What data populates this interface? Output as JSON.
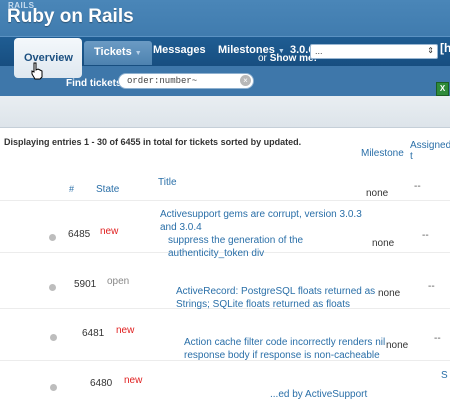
{
  "app": {
    "brand_small": "RAILS",
    "brand_title": "Ruby on Rails"
  },
  "nav": {
    "overview": "Overview",
    "tickets": "Tickets",
    "messages": "Messages",
    "milestones": "Milestones",
    "version": "3.0.6",
    "more": "[h"
  },
  "filter": {
    "find_label": "Find tickets:",
    "search_value": "order:number~",
    "or_label": "or",
    "show_label": "Show me:",
    "show_value": "..."
  },
  "summary": "Displaying entries 1 - 30 of 6455 in total for tickets sorted by updated.",
  "table": {
    "headers": {
      "num": "#",
      "state": "State",
      "title": "Title",
      "milestone": "Milestone",
      "assigned": "Assigned t"
    },
    "rows": [
      {
        "num": "6485",
        "state": "new",
        "title": "Activesupport gems are corrupt, version 3.0.3 and 3.0.4",
        "milestone": "none",
        "assigned": "--"
      },
      {
        "num": "5901",
        "state": "open",
        "title": "suppress the generation of the authenticity_token div",
        "milestone": "none",
        "assigned": "--"
      },
      {
        "num": "6481",
        "state": "new",
        "title": "ActiveRecord: PostgreSQL floats returned as Strings; SQLite floats returned as floats",
        "milestone": "none",
        "assigned": "--"
      },
      {
        "num": "6480",
        "state": "new",
        "title": "Action cache filter code incorrectly renders nil response body if response is non-cacheable",
        "milestone": "none",
        "assigned": "--"
      },
      {
        "num": "",
        "state": "",
        "title": "...ed by ActiveSupport",
        "milestone": "",
        "assigned": ""
      }
    ],
    "edge_text": "S"
  },
  "colors": {
    "header": "#2f6a9e",
    "link": "#2a6fa8",
    "state_new": "#e02020"
  },
  "icons": {
    "cursor": "hand-pointer-icon",
    "excel": "excel-export-icon",
    "clear": "clear-search-icon"
  }
}
